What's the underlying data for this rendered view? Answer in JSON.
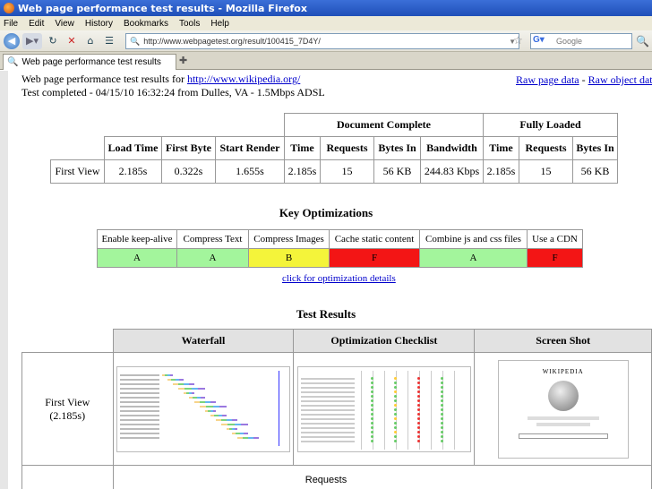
{
  "window": {
    "title": "Web page performance test results - Mozilla Firefox"
  },
  "menu": [
    "File",
    "Edit",
    "View",
    "History",
    "Bookmarks",
    "Tools",
    "Help"
  ],
  "toolbar": {
    "url": "http://www.webpagetest.org/result/100415_7D4Y/",
    "search_placeholder": "Google"
  },
  "tab": {
    "label": "Web page performance test results"
  },
  "page": {
    "heading_prefix": "Web page performance test results for",
    "heading_link": "http://www.wikipedia.org/",
    "test_info": "Test completed - 04/15/10 16:32:24 from Dulles, VA - 1.5Mbps ADSL",
    "raw_page": "Raw page data",
    "raw_sep": " - ",
    "raw_object": "Raw object data"
  },
  "timing": {
    "groups": {
      "document_complete": "Document Complete",
      "fully_loaded": "Fully Loaded"
    },
    "headers": [
      "Load Time",
      "First Byte",
      "Start Render",
      "Time",
      "Requests",
      "Bytes In",
      "Bandwidth",
      "Time",
      "Requests",
      "Bytes In"
    ],
    "row_label": "First View",
    "values": [
      "2.185s",
      "0.322s",
      "1.655s",
      "2.185s",
      "15",
      "56 KB",
      "244.83 Kbps",
      "2.185s",
      "15",
      "56 KB"
    ]
  },
  "optimizations": {
    "title": "Key Optimizations",
    "headers": [
      "Enable keep-alive",
      "Compress Text",
      "Compress Images",
      "Cache static content",
      "Combine js and css files",
      "Use a CDN"
    ],
    "grades": [
      "A",
      "A",
      "B",
      "F",
      "A",
      "F"
    ],
    "details_link": "click for optimization details",
    "grade_colors": {
      "A": "#a3f59c",
      "B": "#f4f43a",
      "F": "#f31515"
    }
  },
  "results": {
    "title": "Test Results",
    "headers": [
      "Waterfall",
      "Optimization Checklist",
      "Screen Shot"
    ],
    "row_label": "First View",
    "row_time": "(2.185s)",
    "thumb_wiki_title": "WIKIPEDIA",
    "requests_label": "Requests"
  }
}
